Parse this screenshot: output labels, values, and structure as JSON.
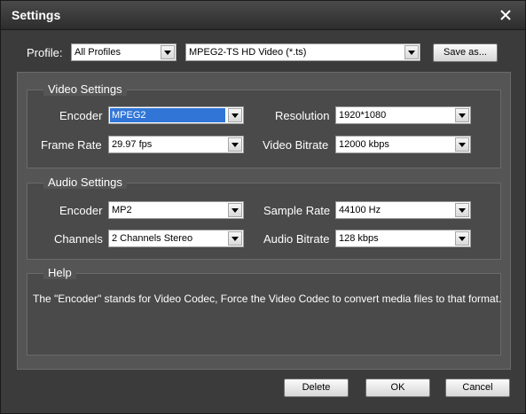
{
  "window": {
    "title": "Settings"
  },
  "profile": {
    "label": "Profile:",
    "category": "All Profiles",
    "format": "MPEG2-TS HD Video (*.ts)",
    "save_as": "Save as..."
  },
  "video": {
    "legend": "Video Settings",
    "encoder_label": "Encoder",
    "encoder_value": "MPEG2",
    "resolution_label": "Resolution",
    "resolution_value": "1920*1080",
    "frame_rate_label": "Frame Rate",
    "frame_rate_value": "29.97 fps",
    "bitrate_label": "Video Bitrate",
    "bitrate_value": "12000 kbps"
  },
  "audio": {
    "legend": "Audio Settings",
    "encoder_label": "Encoder",
    "encoder_value": "MP2",
    "sample_rate_label": "Sample Rate",
    "sample_rate_value": "44100 Hz",
    "channels_label": "Channels",
    "channels_value": "2 Channels Stereo",
    "bitrate_label": "Audio Bitrate",
    "bitrate_value": "128 kbps"
  },
  "help": {
    "legend": "Help",
    "text": "The \"Encoder\" stands for Video Codec, Force the Video Codec to convert media files to that format."
  },
  "footer": {
    "delete": "Delete",
    "ok": "OK",
    "cancel": "Cancel"
  },
  "icons": {
    "close": "close-icon",
    "dropdown": "chevron-down-icon"
  },
  "colors": {
    "selection": "#3176d7",
    "panel": "#555555",
    "background": "#3b3b3b"
  }
}
